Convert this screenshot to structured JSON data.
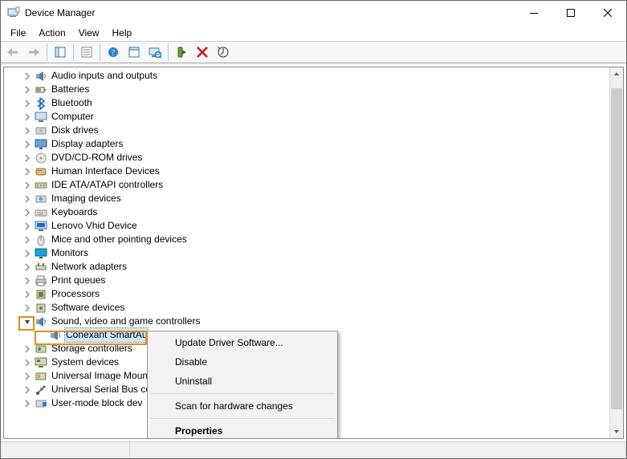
{
  "window": {
    "title": "Device Manager"
  },
  "menu": {
    "file": "File",
    "action": "Action",
    "view": "View",
    "help": "Help"
  },
  "tree": {
    "items": [
      {
        "label": "Audio inputs and outputs",
        "icon": "speaker"
      },
      {
        "label": "Batteries",
        "icon": "battery"
      },
      {
        "label": "Bluetooth",
        "icon": "bluetooth"
      },
      {
        "label": "Computer",
        "icon": "computer"
      },
      {
        "label": "Disk drives",
        "icon": "disk"
      },
      {
        "label": "Display adapters",
        "icon": "display"
      },
      {
        "label": "DVD/CD-ROM drives",
        "icon": "disc"
      },
      {
        "label": "Human Interface Devices",
        "icon": "hid"
      },
      {
        "label": "IDE ATA/ATAPI controllers",
        "icon": "ide"
      },
      {
        "label": "Imaging devices",
        "icon": "imaging"
      },
      {
        "label": "Keyboards",
        "icon": "keyboard"
      },
      {
        "label": "Lenovo Vhid Device",
        "icon": "lenovo"
      },
      {
        "label": "Mice and other pointing devices",
        "icon": "mouse"
      },
      {
        "label": "Monitors",
        "icon": "monitor"
      },
      {
        "label": "Network adapters",
        "icon": "network"
      },
      {
        "label": "Print queues",
        "icon": "printer"
      },
      {
        "label": "Processors",
        "icon": "cpu"
      },
      {
        "label": "Software devices",
        "icon": "software"
      }
    ],
    "expanded": {
      "label": "Sound, video and game controllers",
      "icon": "speaker",
      "child": "Conexant SmartAu"
    },
    "after": [
      {
        "label": "Storage controllers",
        "icon": "storage"
      },
      {
        "label": "System devices",
        "icon": "system"
      },
      {
        "label": "Universal Image Moun",
        "icon": "uim"
      },
      {
        "label": "Universal Serial Bus co",
        "icon": "usb"
      },
      {
        "label": "User-mode block dev",
        "icon": "umb"
      }
    ]
  },
  "ctx": {
    "update": "Update Driver Software...",
    "disable": "Disable",
    "uninstall": "Uninstall",
    "scan": "Scan for hardware changes",
    "properties": "Properties"
  },
  "highlight_color": "#e68a1f"
}
